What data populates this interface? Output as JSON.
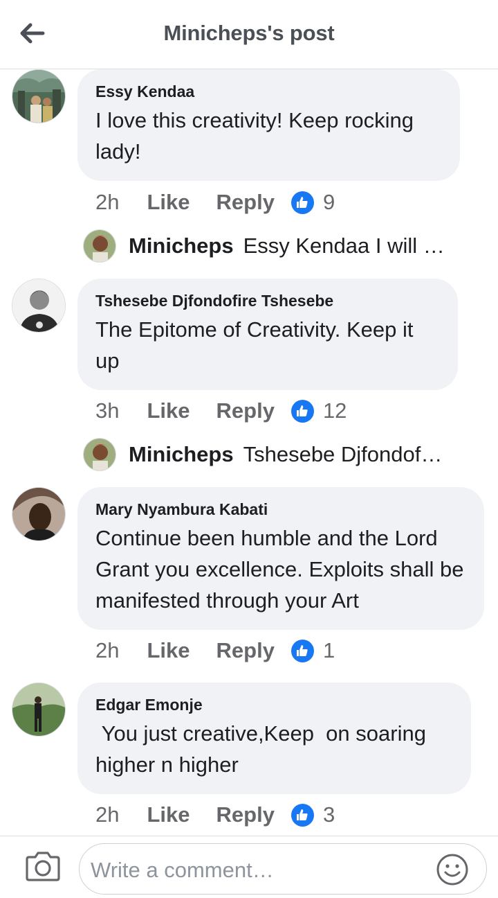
{
  "header": {
    "title": "Minicheps's post",
    "back_icon": "arrow-left-icon"
  },
  "comments": [
    {
      "author": "Essy Kendaa",
      "text": "I love this creativity! Keep rocking lady!",
      "time": "2h",
      "like_label": "Like",
      "reply_label": "Reply",
      "reaction_count": "9",
      "reply": {
        "name": "Minicheps",
        "text": "Essy Kendaa I will …"
      }
    },
    {
      "author": "Tshesebe Djfondofire Tshesebe",
      "text": "The Epitome of Creativity. Keep it up",
      "time": "3h",
      "like_label": "Like",
      "reply_label": "Reply",
      "reaction_count": "12",
      "reply": {
        "name": "Minicheps",
        "text": "Tshesebe Djfondof…"
      }
    },
    {
      "author": "Mary Nyambura Kabati",
      "text": "Continue been humble and the Lord Grant you excellence. Exploits shall be manifested through your Art",
      "time": "2h",
      "like_label": "Like",
      "reply_label": "Reply",
      "reaction_count": "1"
    },
    {
      "author": "Edgar Emonje",
      "text": " You just creative,Keep  on soaring higher n higher",
      "time": "2h",
      "like_label": "Like",
      "reply_label": "Reply",
      "reaction_count": "3"
    }
  ],
  "composer": {
    "placeholder": "Write a comment…",
    "camera_icon": "camera-icon",
    "emoji_icon": "smiley-icon"
  },
  "colors": {
    "like_blue": "#1877f2",
    "bubble_bg": "#f0f2f5",
    "meta_gray": "#65676b"
  }
}
